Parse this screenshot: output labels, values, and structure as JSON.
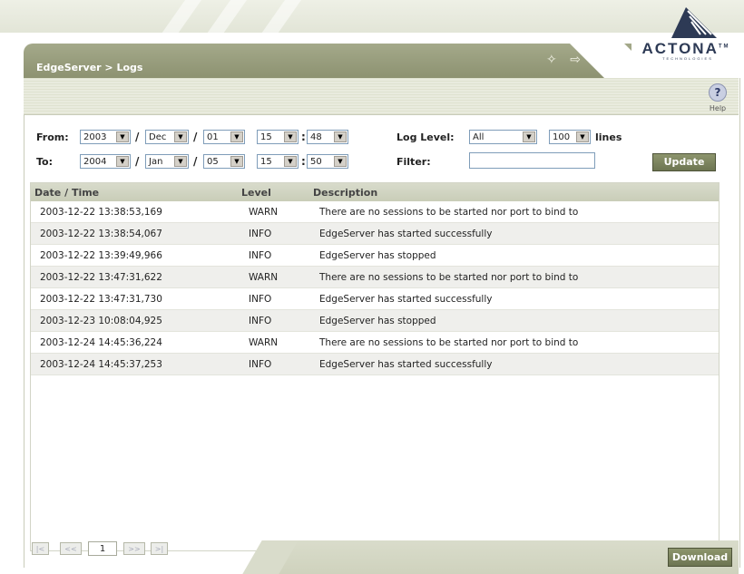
{
  "app": {
    "breadcrumb": "EdgeServer > Logs",
    "logo_text": "ACTONA",
    "logo_tm": "TM",
    "logo_sub": "TECHNOLOGIES"
  },
  "header_icons": [
    "wand-icon",
    "logout-icon"
  ],
  "help": {
    "label": "Help"
  },
  "filter": {
    "from_label": "From:",
    "to_label": "To:",
    "from": {
      "year": "2003",
      "month": "Dec",
      "day": "01",
      "hour": "15",
      "minute": "48"
    },
    "to": {
      "year": "2004",
      "month": "Jan",
      "day": "05",
      "hour": "15",
      "minute": "50"
    },
    "date_sep": "/",
    "time_sep": ":",
    "log_level_label": "Log Level:",
    "log_level_value": "All",
    "lines_value": "100",
    "lines_label": "lines",
    "filter_label": "Filter:",
    "filter_value": "",
    "update_label": "Update"
  },
  "table": {
    "columns": [
      "Date / Time",
      "Level",
      "Description"
    ],
    "rows": [
      {
        "datetime": "2003-12-22 13:38:53,169",
        "level": "WARN",
        "description": "There are no sessions to be started nor port to bind to"
      },
      {
        "datetime": "2003-12-22 13:38:54,067",
        "level": "INFO",
        "description": "EdgeServer has started successfully"
      },
      {
        "datetime": "2003-12-22 13:39:49,966",
        "level": "INFO",
        "description": "EdgeServer has stopped"
      },
      {
        "datetime": "2003-12-22 13:47:31,622",
        "level": "WARN",
        "description": "There are no sessions to be started nor port to bind to"
      },
      {
        "datetime": "2003-12-22 13:47:31,730",
        "level": "INFO",
        "description": "EdgeServer has started successfully"
      },
      {
        "datetime": "2003-12-23 10:08:04,925",
        "level": "INFO",
        "description": "EdgeServer has stopped"
      },
      {
        "datetime": "2003-12-24 14:45:36,224",
        "level": "WARN",
        "description": "There are no sessions to be started nor port to bind to"
      },
      {
        "datetime": "2003-12-24 14:45:37,253",
        "level": "INFO",
        "description": "EdgeServer has started successfully"
      }
    ]
  },
  "pager": {
    "first": "|<",
    "prev": "<<",
    "page": "1",
    "next": ">>",
    "last": ">|"
  },
  "download_label": "Download",
  "colors": {
    "brand_olive": "#8d9271",
    "button_olive": "#6d7552",
    "header_bg": "#c9cdb8",
    "alt_row": "#efefec",
    "logo_navy": "#2d3a55"
  }
}
